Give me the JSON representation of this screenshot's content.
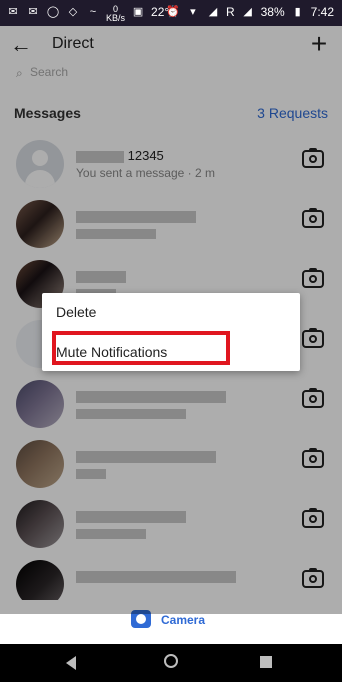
{
  "status_bar": {
    "speed": "0",
    "speed_unit": "KB/s",
    "temperature": "22°",
    "carrier_indicator": "R",
    "battery": "38%",
    "time": "7:42"
  },
  "header": {
    "title": "Direct"
  },
  "search": {
    "placeholder": "Search"
  },
  "messages": {
    "title": "Messages",
    "requests": "3 Requests"
  },
  "conversations": [
    {
      "name": "12345",
      "preview": "You sent a message · 2 m"
    }
  ],
  "dialog": {
    "items": [
      "Delete",
      "Mute Notifications"
    ]
  },
  "bottom": {
    "camera_label": "Camera"
  },
  "colors": {
    "accent": "#2f6ad5",
    "highlight": "#e0161f"
  }
}
